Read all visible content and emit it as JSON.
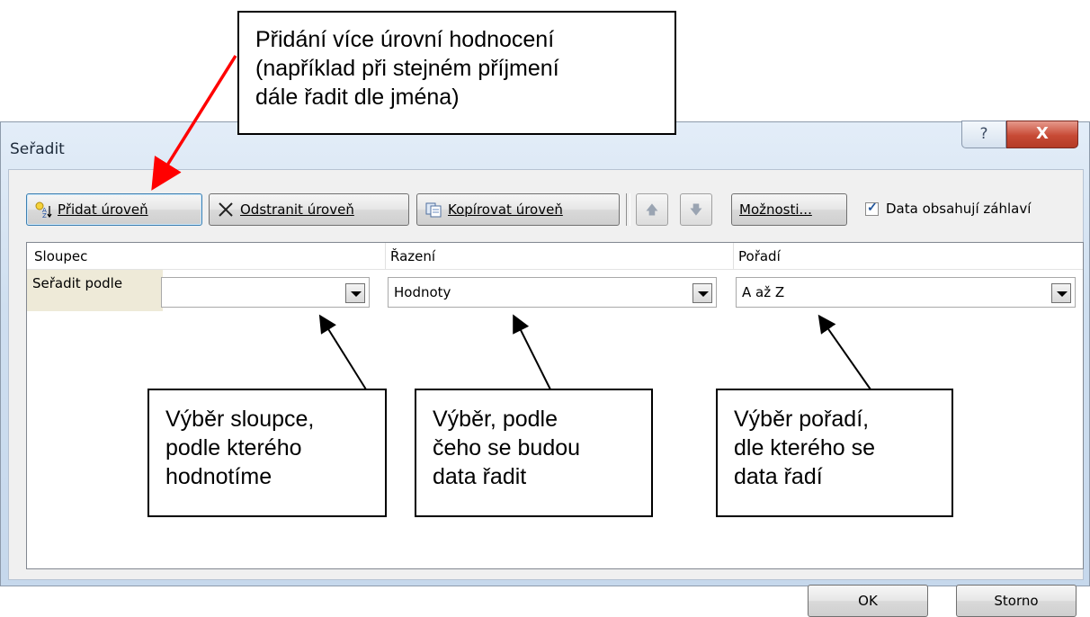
{
  "dialog": {
    "title": "Seřadit",
    "help_glyph": "?",
    "close_glyph": "X"
  },
  "toolbar": {
    "add_level": "Přidat úroveň",
    "delete_level": "Odstranit úroveň",
    "copy_level": "Kopírovat úroveň",
    "move_up_glyph": "🡅",
    "move_down_glyph": "🡇",
    "options": "Možnosti...",
    "header_checkbox_label": "Data obsahují záhlaví",
    "header_checkbox_checked": true
  },
  "grid": {
    "headers": {
      "column": "Sloupec",
      "sort_on": "Řazení",
      "order": "Pořadí"
    },
    "row": {
      "label": "Seřadit podle",
      "column_value": "",
      "sort_on_value": "Hodnoty",
      "order_value": "A až Z"
    }
  },
  "footer": {
    "ok": "OK",
    "cancel": "Storno"
  },
  "annotations": {
    "top": [
      "Přidání více úrovní hodnocení",
      "(například při stejném příjmení",
      "dále řadit dle jména)"
    ],
    "column": [
      "Výběr sloupce,",
      "podle kterého",
      "hodnotíme"
    ],
    "sort_on": [
      "Výběr, podle",
      "čeho se budou",
      "data řadit"
    ],
    "order": [
      "Výběr pořadí,",
      "dle kterého se",
      "data řadí"
    ]
  },
  "colors": {
    "arrow_red": "#ff0000",
    "row_label_bg": "#eeead8",
    "close_red": "#c74a35"
  }
}
